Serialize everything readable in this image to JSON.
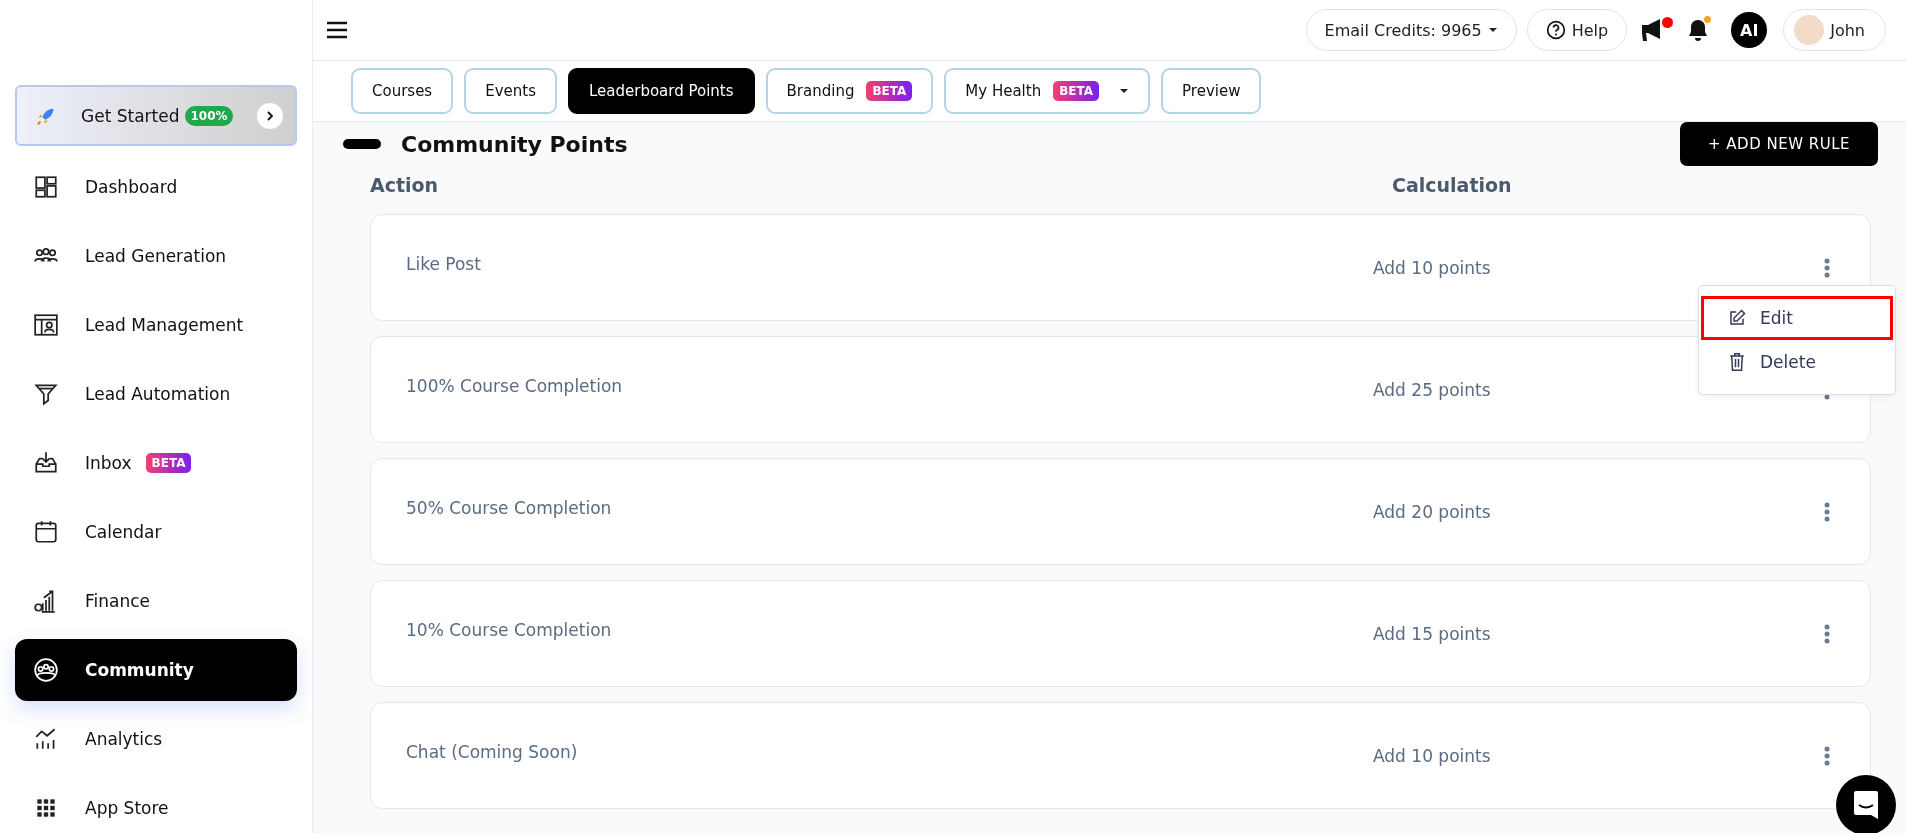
{
  "sidebar": {
    "get_started": {
      "label": "Get Started",
      "badge": "100%"
    },
    "items": [
      {
        "label": "Dashboard",
        "selected": false
      },
      {
        "label": "Lead Generation",
        "selected": false
      },
      {
        "label": "Lead Management",
        "selected": false
      },
      {
        "label": "Lead Automation",
        "selected": false
      },
      {
        "label": "Inbox",
        "badge": "BETA",
        "selected": false
      },
      {
        "label": "Calendar",
        "selected": false
      },
      {
        "label": "Finance",
        "selected": false
      },
      {
        "label": "Community",
        "selected": true
      },
      {
        "label": "Analytics",
        "selected": false
      },
      {
        "label": "App Store",
        "selected": false
      }
    ]
  },
  "topbar": {
    "email_credits": "Email Credits: 9965",
    "help": "Help",
    "announcement_dot": true,
    "notification_dot": true,
    "ai": "AI",
    "user": "John"
  },
  "tabs": [
    {
      "label": "Courses",
      "selected": false
    },
    {
      "label": "Events",
      "selected": false
    },
    {
      "label": "Leaderboard Points",
      "selected": true
    },
    {
      "label": "Branding",
      "badge": "BETA",
      "selected": false
    },
    {
      "label": "My Health",
      "badge": "BETA",
      "dropdown": true,
      "selected": false
    },
    {
      "label": "Preview",
      "selected": false
    }
  ],
  "section": {
    "title": "Community Points",
    "add_button": "+ ADD NEW RULE"
  },
  "table": {
    "columns": [
      "Action",
      "Calculation"
    ],
    "rows": [
      {
        "action": "Like Post",
        "calculation": "Add 10 points",
        "menu": [
          {
            "kind": "edit",
            "label": "Edit",
            "highlighted": true
          },
          {
            "kind": "delete",
            "label": "Delete",
            "highlighted": false
          }
        ]
      },
      {
        "action": "100% Course Completion",
        "calculation": "Add 25 points"
      },
      {
        "action": "50% Course Completion",
        "calculation": "Add 20 points"
      },
      {
        "action": "10% Course Completion",
        "calculation": "Add 15 points"
      },
      {
        "action": "Chat (Coming Soon)",
        "calculation": "Add 10 points"
      }
    ]
  }
}
